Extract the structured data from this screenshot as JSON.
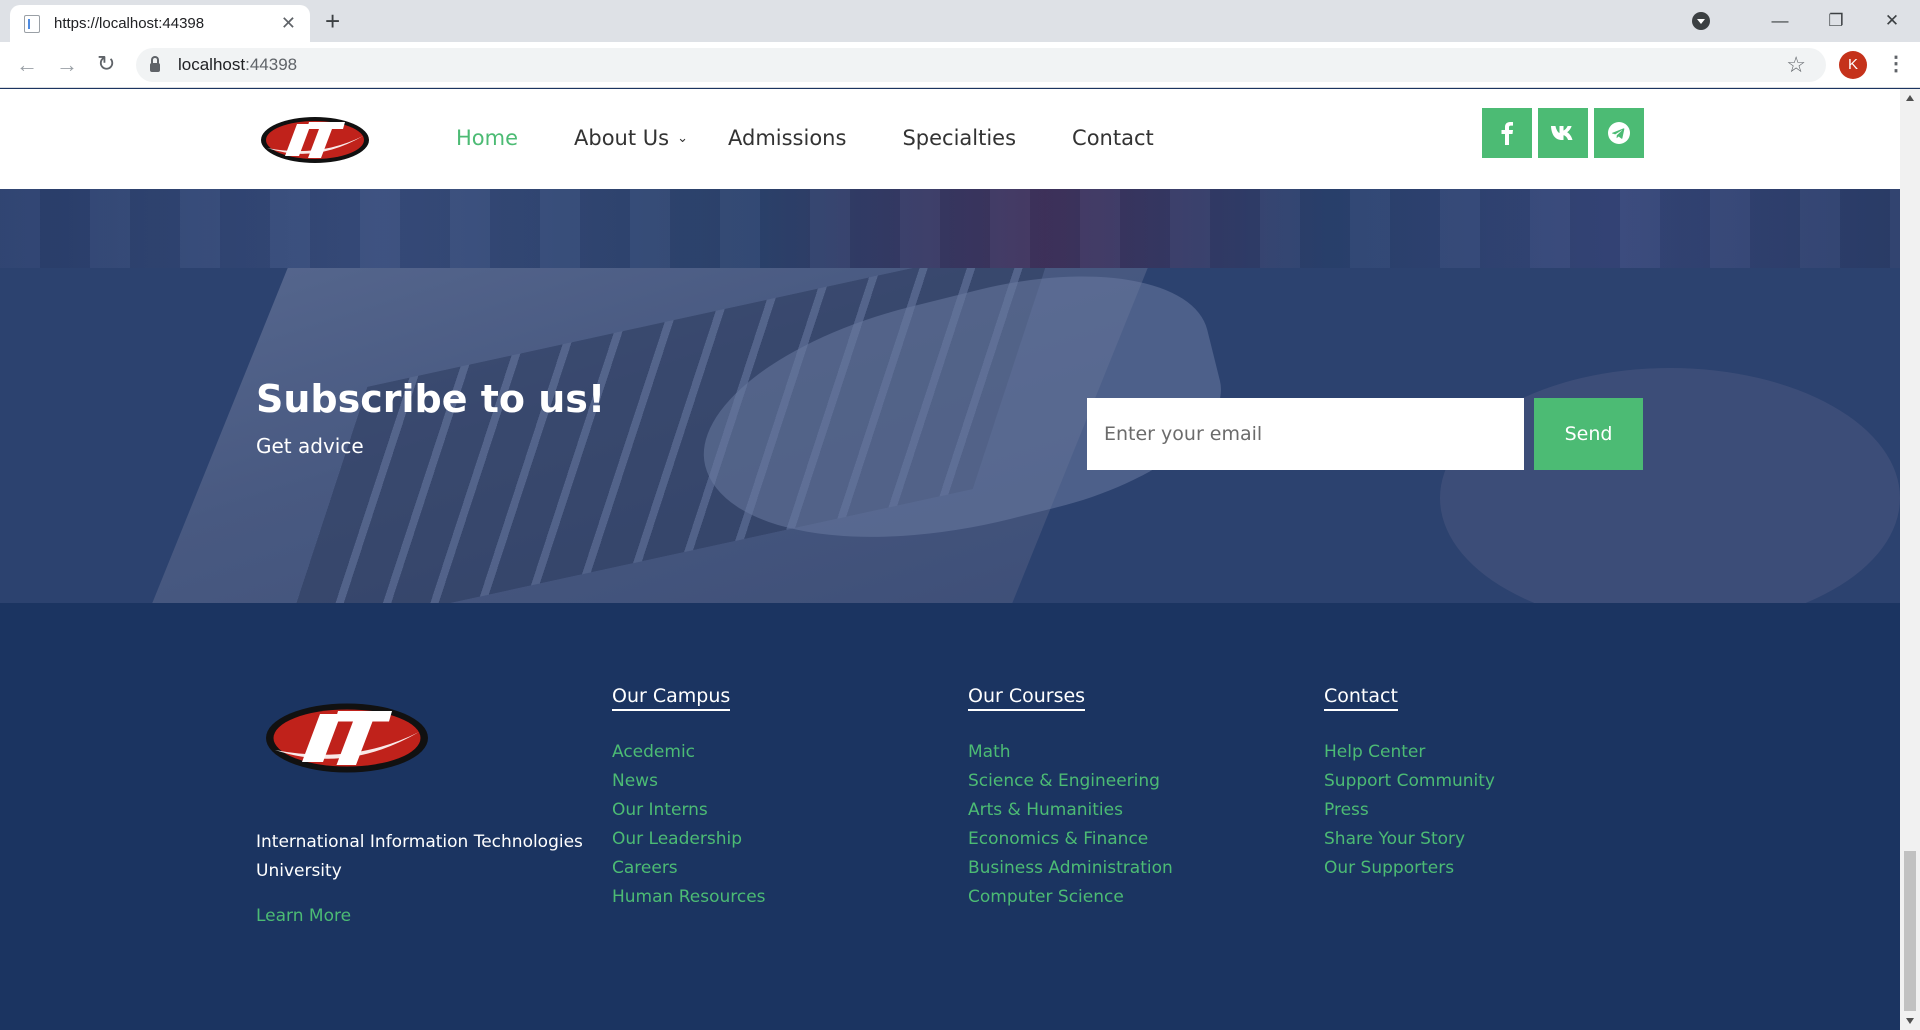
{
  "browser": {
    "tab_title": "https://localhost:44398",
    "url_host": "localhost",
    "url_port": ":44398",
    "avatar_letter": "K"
  },
  "header": {
    "nav": {
      "home": "Home",
      "about": "About Us",
      "admissions": "Admissions",
      "specialties": "Specialties",
      "contact": "Contact"
    },
    "social": [
      "facebook-icon",
      "vk-icon",
      "telegram-icon"
    ]
  },
  "subscribe": {
    "title": "Subscribe to us!",
    "subtitle": "Get advice",
    "email_placeholder": "Enter your email",
    "send_label": "Send"
  },
  "footer": {
    "university": "International Information Technologies University",
    "learn_more": "Learn More",
    "campus": {
      "title": "Our Campus",
      "items": [
        "Acedemic",
        "News",
        "Our Interns",
        "Our Leadership",
        "Careers",
        "Human Resources"
      ]
    },
    "courses": {
      "title": "Our Courses",
      "items": [
        "Math",
        "Science & Engineering",
        "Arts & Humanities",
        "Economics & Finance",
        "Business Administration",
        "Computer Science"
      ]
    },
    "contact": {
      "title": "Contact",
      "items": [
        "Help Center",
        "Support Community",
        "Press",
        "Share Your Story",
        "Our Supporters"
      ]
    }
  },
  "colors": {
    "accent": "#4cbb74",
    "footer_bg": "#1b3461",
    "overlay": "#2c426f"
  }
}
